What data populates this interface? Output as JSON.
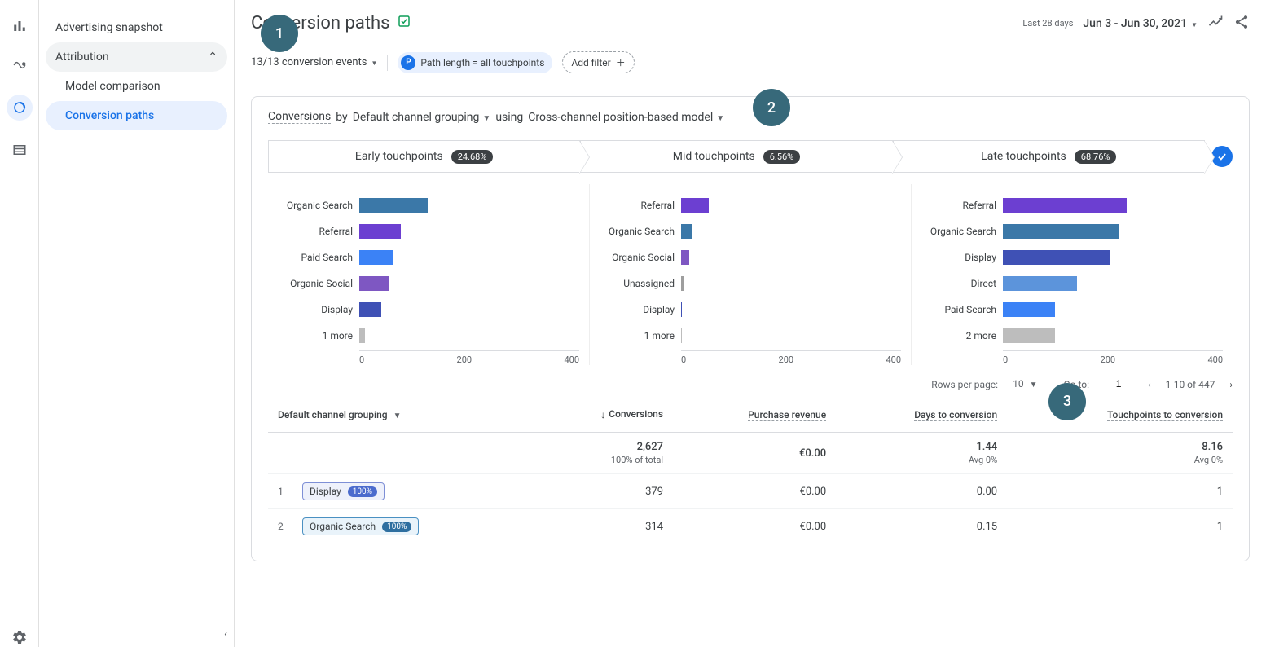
{
  "sidebar": {
    "snapshot": "Advertising snapshot",
    "attribution": "Attribution",
    "model_comparison": "Model comparison",
    "conversion_paths": "Conversion paths"
  },
  "header": {
    "title": "Conversion paths",
    "last_label": "Last 28 days",
    "date_range": "Jun 3 - Jun 30, 2021"
  },
  "filters": {
    "events_label": "13/13 conversion events",
    "path_chip_badge": "P",
    "path_chip_text": "Path length = all touchpoints",
    "add_filter": "Add filter"
  },
  "card": {
    "title_prefix": "Conversions",
    "title_by": " by ",
    "grouping": "Default channel grouping",
    "using": " using ",
    "model": "Cross-channel position-based model",
    "tabs": [
      {
        "label": "Early touchpoints",
        "pct": "24.68%"
      },
      {
        "label": "Mid touchpoints",
        "pct": "6.56%"
      },
      {
        "label": "Late touchpoints",
        "pct": "68.76%"
      }
    ]
  },
  "chart_data": [
    {
      "type": "bar",
      "title": "Early touchpoints",
      "xlim": [
        0,
        400
      ],
      "ticks": [
        "0",
        "200",
        "400"
      ],
      "categories": [
        "Organic Search",
        "Referral",
        "Paid Search",
        "Organic Social",
        "Display",
        "1 more"
      ],
      "values": [
        125,
        75,
        60,
        55,
        40,
        10
      ],
      "colors": [
        "c-organic-search",
        "c-referral",
        "c-paid-search",
        "c-organic-social",
        "c-display",
        "c-more"
      ]
    },
    {
      "type": "bar",
      "title": "Mid touchpoints",
      "xlim": [
        0,
        400
      ],
      "ticks": [
        "0",
        "200",
        "400"
      ],
      "categories": [
        "Referral",
        "Organic Search",
        "Organic Social",
        "Unassigned",
        "Display",
        "1 more"
      ],
      "values": [
        50,
        20,
        15,
        5,
        2,
        2
      ],
      "colors": [
        "c-referral",
        "c-organic-search",
        "c-organic-social",
        "c-unassigned",
        "c-display",
        "c-more"
      ]
    },
    {
      "type": "bar",
      "title": "Late touchpoints",
      "xlim": [
        0,
        400
      ],
      "ticks": [
        "0",
        "200",
        "400"
      ],
      "categories": [
        "Referral",
        "Organic Search",
        "Display",
        "Direct",
        "Paid Search",
        "2 more"
      ],
      "values": [
        225,
        210,
        195,
        135,
        95,
        95
      ],
      "colors": [
        "c-referral",
        "c-organic-search",
        "c-display",
        "c-direct",
        "c-paid-search",
        "c-more"
      ]
    }
  ],
  "table": {
    "controls": {
      "rows_label": "Rows per page:",
      "rows_value": "10",
      "goto_label": "Go to:",
      "goto_value": "1",
      "range": "1-10 of 447"
    },
    "headers": {
      "grouping": "Default channel grouping",
      "conversions": "Conversions",
      "revenue": "Purchase revenue",
      "days": "Days to conversion",
      "touchpoints": "Touchpoints to conversion"
    },
    "totals": {
      "conversions": "2,627",
      "conversions_sub": "100% of total",
      "revenue": "€0.00",
      "days": "1.44",
      "days_sub": "Avg 0%",
      "touchpoints": "8.16",
      "touchpoints_sub": "Avg 0%"
    },
    "rows": [
      {
        "idx": "1",
        "chip_label": "Display",
        "chip_pct": "100%",
        "chip_class": "",
        "conversions": "379",
        "revenue": "€0.00",
        "days": "0.00",
        "touchpoints": "1"
      },
      {
        "idx": "2",
        "chip_label": "Organic Search",
        "chip_pct": "100%",
        "chip_class": "organic",
        "conversions": "314",
        "revenue": "€0.00",
        "days": "0.15",
        "touchpoints": "1"
      }
    ]
  },
  "callouts": {
    "c1": "1",
    "c2": "2",
    "c3": "3"
  }
}
